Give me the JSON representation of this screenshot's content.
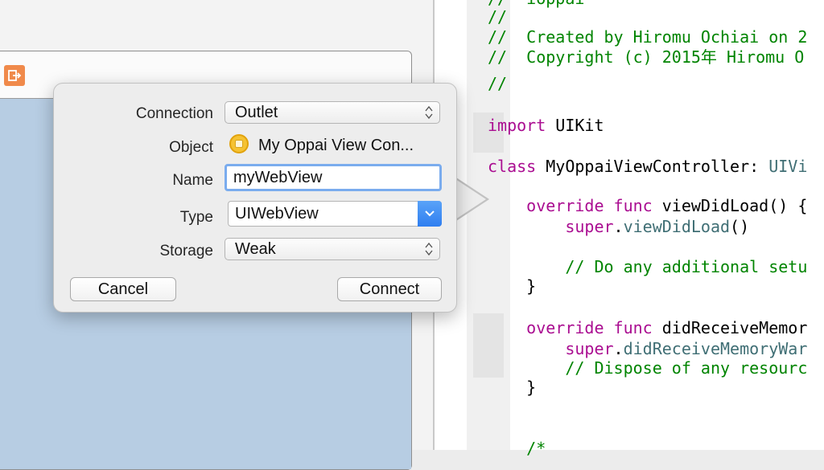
{
  "canvas": {
    "exit_icon": "exit-icon"
  },
  "popover": {
    "connection": {
      "label": "Connection",
      "value": "Outlet"
    },
    "object": {
      "label": "Object",
      "value": "My Oppai View Con...",
      "icon": "view-controller-icon"
    },
    "name": {
      "label": "Name",
      "value": "myWebView"
    },
    "type": {
      "label": "Type",
      "value": "UIWebView"
    },
    "storage": {
      "label": "Storage",
      "value": "Weak"
    },
    "cancel_label": "Cancel",
    "connect_label": "Connect"
  },
  "editor": {
    "lines": [
      [
        [
          "comment",
          "//  ioppai"
        ]
      ],
      [
        [
          "comment",
          "//"
        ]
      ],
      [
        [
          "comment",
          "//  Created by Hiromu Ochiai on 2"
        ]
      ],
      [
        [
          "comment",
          "//  Copyright (c) 2015年 Hiromu O"
        ]
      ],
      [
        [
          "comment",
          "//"
        ]
      ],
      [
        [
          "keyword",
          "import"
        ],
        [
          "plain",
          " UIKit"
        ]
      ],
      [
        [
          "keyword",
          "class"
        ],
        [
          "plain",
          " MyOppaiViewController: "
        ],
        [
          "type",
          "UIVi"
        ]
      ],
      [
        [
          "keyword",
          "    override func"
        ],
        [
          "plain",
          " viewDidLoad() {"
        ]
      ],
      [
        [
          "keyword",
          "        super"
        ],
        [
          "plain",
          "."
        ],
        [
          "type",
          "viewDidLoad"
        ],
        [
          "plain",
          "()"
        ]
      ],
      [
        [
          "comment",
          "        // Do any additional setu"
        ]
      ],
      [
        [
          "plain",
          "    }"
        ]
      ],
      [
        [
          "keyword",
          "    override func"
        ],
        [
          "plain",
          " didReceiveMemor"
        ]
      ],
      [
        [
          "keyword",
          "        super"
        ],
        [
          "plain",
          "."
        ],
        [
          "type",
          "didReceiveMemoryWar"
        ]
      ],
      [
        [
          "comment",
          "        // Dispose of any resourc"
        ]
      ],
      [
        [
          "plain",
          "    }"
        ]
      ],
      [
        [
          "comment",
          "    /*"
        ]
      ]
    ]
  },
  "colors": {
    "comment": "#008400",
    "keyword": "#aa0d91",
    "type": "#3f6e74",
    "canvas_view": "#b7cde3",
    "exit_icon": "#f08a4b",
    "focus_ring": "#7aacee"
  }
}
